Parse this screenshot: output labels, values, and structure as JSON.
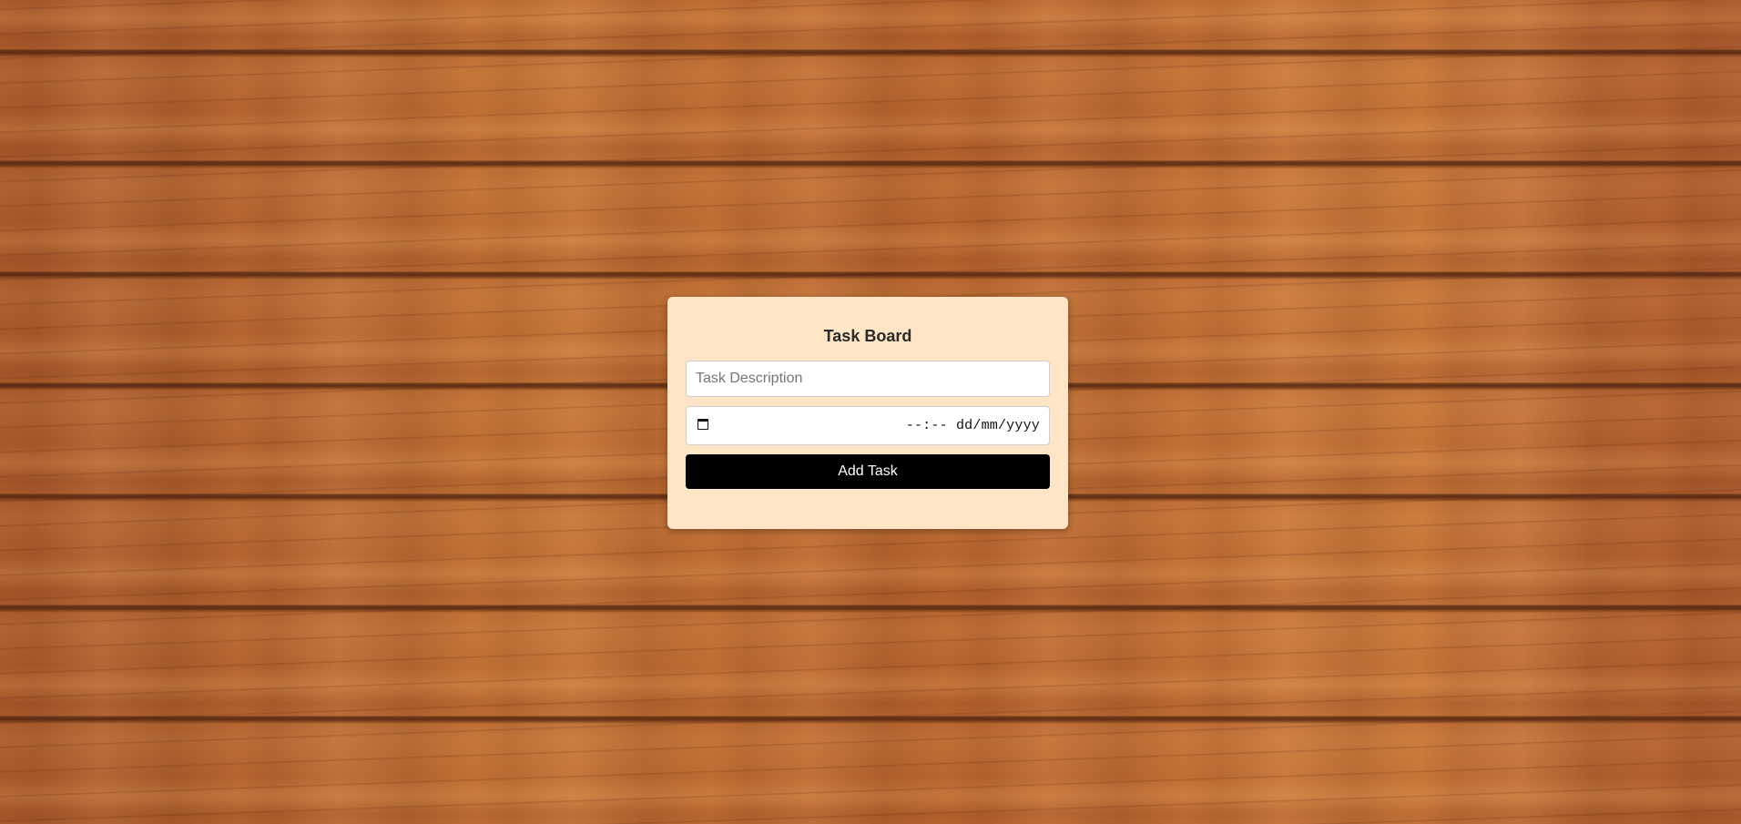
{
  "board": {
    "title": "Task Board",
    "description_placeholder": "Task Description",
    "description_value": "",
    "datetime_placeholder": "--:-- dd/mm/yyyy",
    "add_button_label": "Add Task"
  },
  "icons": {
    "calendar": "calendar-icon"
  },
  "colors": {
    "card_background": "#fde5c6",
    "button_background": "#000000",
    "button_text": "#ffffff"
  }
}
